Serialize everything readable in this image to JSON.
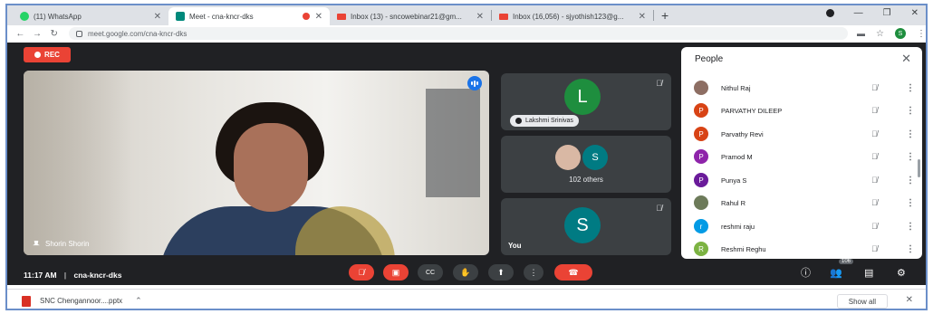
{
  "browser": {
    "tabs": [
      {
        "title": "(11) WhatsApp",
        "icon": "whatsapp-icon",
        "color": "#25d366"
      },
      {
        "title": "Meet - cna-kncr-dks",
        "icon": "meet-icon",
        "color": "#00897b"
      },
      {
        "title": "Inbox (13) - sncowebinar21@gm...",
        "icon": "gmail-icon",
        "color": "#ea4335"
      },
      {
        "title": "Inbox (16,056) - sjyothish123@g...",
        "icon": "gmail-icon",
        "color": "#ea4335"
      }
    ],
    "url": "meet.google.com/cna-kncr-dks",
    "profile_initial": "S"
  },
  "meet": {
    "rec_label": "REC",
    "main_speaker": "Shorin Shorin",
    "tiles": {
      "lakshmi": {
        "initial": "L",
        "name": "Lakshmi Srinivas",
        "color": "#1e8e3e"
      },
      "others": {
        "initial": "S",
        "label": "102 others",
        "color": "#007b83"
      },
      "you": {
        "initial": "S",
        "label": "You",
        "color": "#007b83"
      }
    },
    "time": "11:17 AM",
    "meeting_code": "cna-kncr-dks",
    "participant_count": "106"
  },
  "people": {
    "title": "People",
    "list": [
      {
        "name": "Nithul Raj",
        "initial": "",
        "color": "#8d6e63"
      },
      {
        "name": "PARVATHY DILEEP",
        "initial": "P",
        "color": "#d84315"
      },
      {
        "name": "Parvathy Revi",
        "initial": "P",
        "color": "#d84315"
      },
      {
        "name": "Pramod M",
        "initial": "P",
        "color": "#8e24aa"
      },
      {
        "name": "Punya S",
        "initial": "P",
        "color": "#6a1b9a"
      },
      {
        "name": "Rahul R",
        "initial": "",
        "color": "#6d7b5a"
      },
      {
        "name": "reshmi raju",
        "initial": "r",
        "color": "#039be5"
      },
      {
        "name": "Reshmi Reghu",
        "initial": "R",
        "color": "#7cb342"
      }
    ]
  },
  "downloads": {
    "file": "SNC Chengannoor....pptx",
    "show_all": "Show all"
  }
}
